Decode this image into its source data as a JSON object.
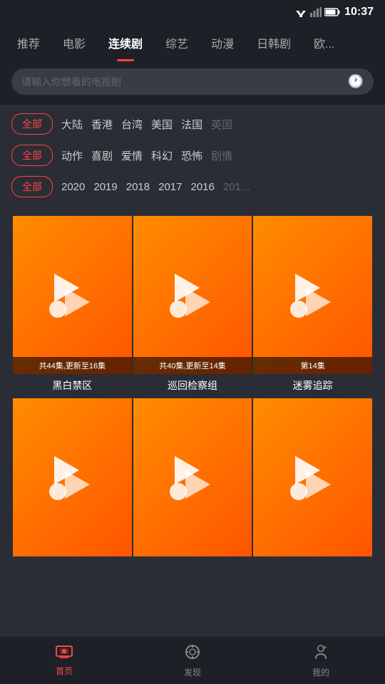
{
  "statusBar": {
    "time": "10:37"
  },
  "nav": {
    "items": [
      {
        "label": "推荐",
        "active": false
      },
      {
        "label": "电影",
        "active": false
      },
      {
        "label": "连续剧",
        "active": true
      },
      {
        "label": "综艺",
        "active": false
      },
      {
        "label": "动漫",
        "active": false
      },
      {
        "label": "日韩剧",
        "active": false
      },
      {
        "label": "欧...",
        "active": false
      }
    ]
  },
  "search": {
    "placeholder": "请输入你想看的电视剧"
  },
  "filters": {
    "row1": {
      "allLabel": "全部",
      "items": [
        "大陆",
        "香港",
        "台湾",
        "美国",
        "法国",
        "英国"
      ]
    },
    "row2": {
      "allLabel": "全部",
      "items": [
        "动作",
        "喜剧",
        "爱情",
        "科幻",
        "恐怖",
        "剧情"
      ]
    },
    "row3": {
      "allLabel": "全部",
      "items": [
        "2020",
        "2019",
        "2018",
        "2017",
        "2016",
        "201..."
      ]
    }
  },
  "grid": {
    "items": [
      {
        "title": "黑白禁区",
        "badge": "共44集,更新至16集",
        "showBadge": true
      },
      {
        "title": "巡回检察组",
        "badge": "共40集,更新至14集",
        "showBadge": true
      },
      {
        "title": "迷雾追踪",
        "badge": "第14集",
        "showBadge": true
      },
      {
        "title": "",
        "badge": "",
        "showBadge": false
      },
      {
        "title": "",
        "badge": "",
        "showBadge": false
      },
      {
        "title": "",
        "badge": "",
        "showBadge": false
      }
    ]
  },
  "bottomNav": {
    "items": [
      {
        "label": "首页",
        "active": true
      },
      {
        "label": "发现",
        "active": false
      },
      {
        "label": "我的",
        "active": false
      }
    ]
  }
}
